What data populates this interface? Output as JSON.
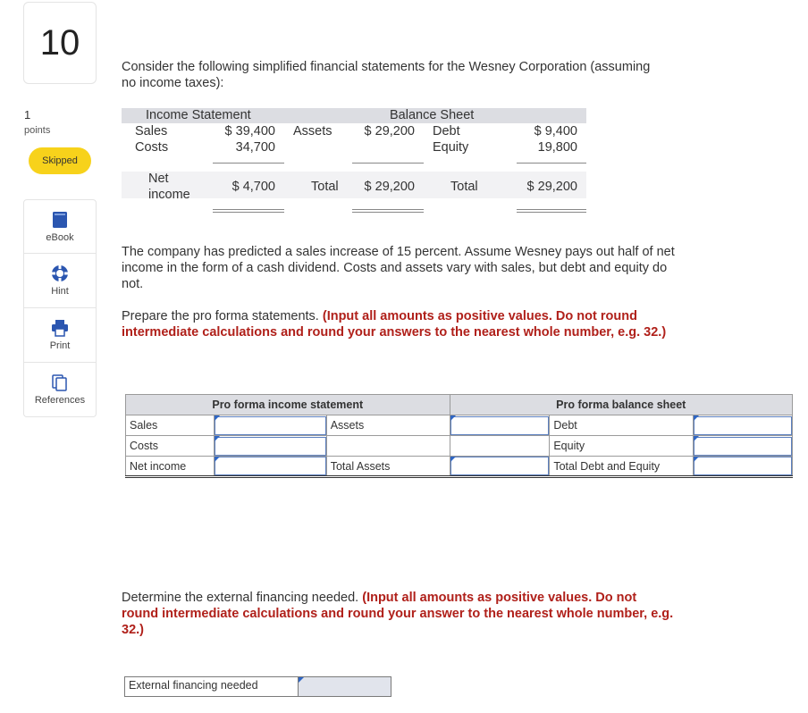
{
  "question": {
    "number": "10",
    "points_value": "1",
    "points_label": "points",
    "status": "Skipped"
  },
  "tools": [
    {
      "label": "eBook",
      "icon": "book-icon"
    },
    {
      "label": "Hint",
      "icon": "hint-icon"
    },
    {
      "label": "Print",
      "icon": "print-icon"
    },
    {
      "label": "References",
      "icon": "references-icon"
    }
  ],
  "intro": "Consider the following simplified financial statements for the Wesney Corporation (assuming no income taxes):",
  "statements": {
    "income_title": "Income Statement",
    "balance_title": "Balance Sheet",
    "sales_label": "Sales",
    "sales_value": "$ 39,400",
    "costs_label": "Costs",
    "costs_value": "34,700",
    "net_income_label_1": "Net",
    "net_income_label_2": "income",
    "net_income_value": "$ 4,700",
    "assets_label": "Assets",
    "assets_value": "$ 29,200",
    "debt_label": "Debt",
    "debt_value": "$ 9,400",
    "equity_label": "Equity",
    "equity_value": "19,800",
    "total_left_label": "Total",
    "total_left_value": "$ 29,200",
    "total_right_label": "Total",
    "total_right_value": "$ 29,200"
  },
  "paragraph_1": "The company has predicted a sales increase of 15 percent. Assume Wesney pays out half of net income in the form of a cash dividend. Costs and assets vary with sales, but debt and equity do not.",
  "paragraph_2_text": "Prepare the pro forma statements. ",
  "paragraph_2_bold": "(Input all amounts as positive values. Do not round intermediate calculations and round your answers to the nearest whole number, e.g. 32.)",
  "proforma": {
    "income_header": "Pro forma income statement",
    "balance_header": "Pro forma balance sheet",
    "rows": [
      {
        "left": "Sales",
        "mid": "Assets",
        "right": "Debt"
      },
      {
        "left": "Costs",
        "mid": "",
        "right": "Equity"
      },
      {
        "left": "Net income",
        "mid": "Total Assets",
        "right": "Total Debt and Equity"
      }
    ]
  },
  "paragraph_3_bold_1": "(Input all amounts as positive values. Do not round intermediate calculations and round your answer to the nearest whole number, e.g. 32.)",
  "paragraph_3_text": "Determine the external financing needed. ",
  "external": {
    "label": "External financing needed",
    "value": ""
  },
  "colors": {
    "skipped_badge": "#f7d21b",
    "instruction_red": "#b0201a",
    "header_gray": "#dcdde2",
    "input_blue": "#2f66c4"
  }
}
